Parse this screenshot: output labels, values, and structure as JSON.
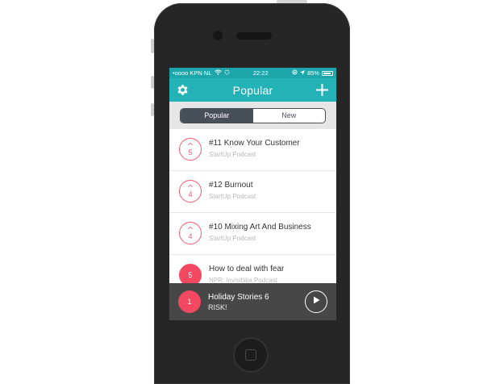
{
  "status_bar": {
    "carrier": "•oooo KPN NL",
    "time": "22:22",
    "battery": "85%"
  },
  "nav": {
    "title": "Popular",
    "settings_icon": "gear-icon",
    "add_icon": "plus-icon"
  },
  "segments": {
    "popular": "Popular",
    "new": "New",
    "selected": "Popular"
  },
  "items": [
    {
      "votes": "5",
      "title": "#11 Know Your Customer",
      "subtitle": "StartUp Podcast",
      "voted": false
    },
    {
      "votes": "4",
      "title": "#12 Burnout",
      "subtitle": "StartUp Podcast",
      "voted": false
    },
    {
      "votes": "4",
      "title": "#10 Mixing Art And Business",
      "subtitle": "StartUp Podcast",
      "voted": false
    },
    {
      "votes": "5",
      "title": "How to deal with fear",
      "subtitle": "NPR: Invisibilia Podcast",
      "voted": true
    }
  ],
  "player": {
    "rank": "1",
    "title": "Holiday Stories 6",
    "subtitle": "RISK!",
    "play_icon": "play-icon"
  },
  "colors": {
    "teal": "#23b2b5",
    "accent": "#f34861",
    "dark": "#474f59"
  }
}
